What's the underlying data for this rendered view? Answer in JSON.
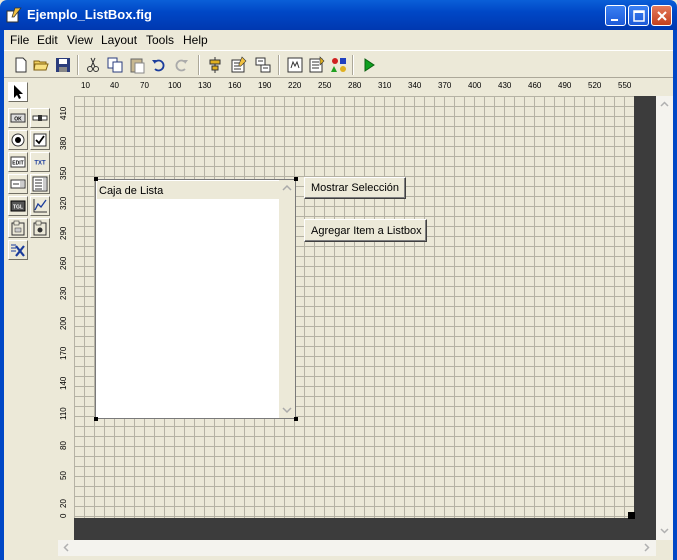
{
  "window": {
    "title": "Ejemplo_ListBox.fig"
  },
  "menu": [
    "File",
    "Edit",
    "View",
    "Layout",
    "Tools",
    "Help"
  ],
  "toolbar_icons": [
    "new-file-icon",
    "open-folder-icon",
    "save-icon",
    "cut-icon",
    "copy-icon",
    "paste-icon",
    "undo-icon",
    "redo-icon",
    "align-icon",
    "menu-editor-icon",
    "tab-order-icon",
    "m-file-editor-icon",
    "property-inspector-icon",
    "object-browser-icon",
    "run-icon"
  ],
  "palette_icons": [
    "select-arrow-icon",
    "push-button-icon",
    "slider-icon",
    "radio-button-icon",
    "checkbox-icon",
    "edit-text-icon",
    "static-text-icon",
    "popup-menu-icon",
    "listbox-icon",
    "toggle-button-icon",
    "axes-icon",
    "panel-icon",
    "button-group-icon",
    "activex-icon"
  ],
  "palette_text": {
    "ok": "OK",
    "edit": "EDIT",
    "txt": "TXT",
    "tgl": "TGL"
  },
  "hruler": [
    "10",
    "40",
    "70",
    "100",
    "130",
    "160",
    "190",
    "220",
    "250",
    "280",
    "310",
    "340",
    "370",
    "400",
    "430",
    "460",
    "490",
    "520",
    "550"
  ],
  "vruler": [
    "410",
    "380",
    "350",
    "320",
    "290",
    "260",
    "230",
    "200",
    "170",
    "140",
    "110",
    "80",
    "50",
    "20",
    "0"
  ],
  "listbox": {
    "item": "Caja de Lista"
  },
  "buttons": {
    "show_selection": "Mostrar Selección",
    "add_item": "Agregar Item a Listbox"
  }
}
